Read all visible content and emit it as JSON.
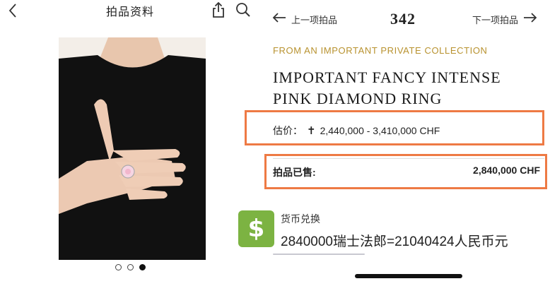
{
  "left_header": {
    "title": "拍品资料"
  },
  "carousel": {
    "dots_total": 3,
    "active_index": 2
  },
  "right_header": {
    "prev_label": "上一项拍品",
    "lot_number": "342",
    "next_label": "下一项拍品"
  },
  "lot": {
    "provenance": "FROM AN IMPORTANT PRIVATE COLLECTION",
    "title": "IMPORTANT FANCY INTENSE PINK DIAMOND RING",
    "estimate_label": "估价：",
    "estimate_value": "2,440,000 - 3,410,000 CHF",
    "sold_label": "拍品已售:",
    "sold_value": "2,840,000 CHF"
  },
  "currency": {
    "icon_glyph": "$",
    "title": "货币兑换",
    "result": "2840000瑞士法郎=21040424人民币元"
  },
  "colors": {
    "accent_gold": "#b8922f",
    "highlight_box": "#ee7a44",
    "currency_green": "#7cb342"
  },
  "icons": [
    "back-chevron-icon",
    "share-icon",
    "search-icon",
    "arrow-left-icon",
    "arrow-right-icon",
    "dagger-icon",
    "dollar-icon"
  ]
}
